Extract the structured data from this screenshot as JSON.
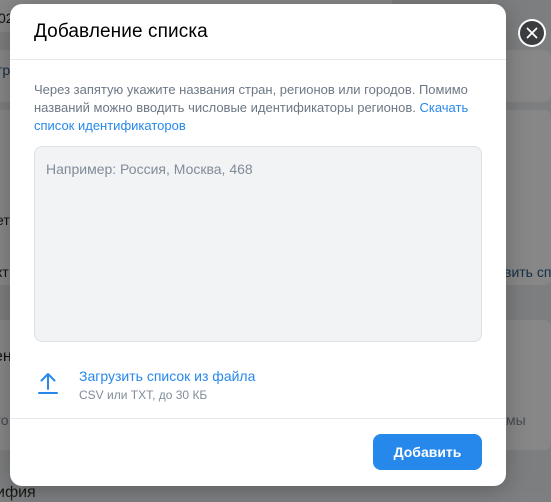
{
  "background": {
    "fragments": {
      "f1": "02",
      "f2": "тр",
      "f3": "ет",
      "f4": "кт",
      "f5": "ен",
      "f6": "го",
      "f7": "ифия",
      "f8": "вить сп",
      "f9": "мы"
    }
  },
  "modal": {
    "title": "Добавление списка",
    "description": "Через запятую укажите названия стран, регионов или городов. Помимо названий можно вводить числовые идентификаторы регионов.",
    "ids_link": "Скачать список идентификаторов",
    "textarea_value": "",
    "textarea_placeholder": "Например: Россия, Москва, 468",
    "upload_label": "Загрузить список из файла",
    "upload_hint": "CSV или TXT, до 30 КБ",
    "submit_label": "Добавить"
  },
  "icons": {
    "close": "close-icon",
    "upload": "upload-arrow-icon"
  },
  "colors": {
    "accent": "#2688eb",
    "muted_text": "#6d7885",
    "placeholder": "#818c99",
    "overlay": "rgba(0,0,0,0.47)"
  }
}
